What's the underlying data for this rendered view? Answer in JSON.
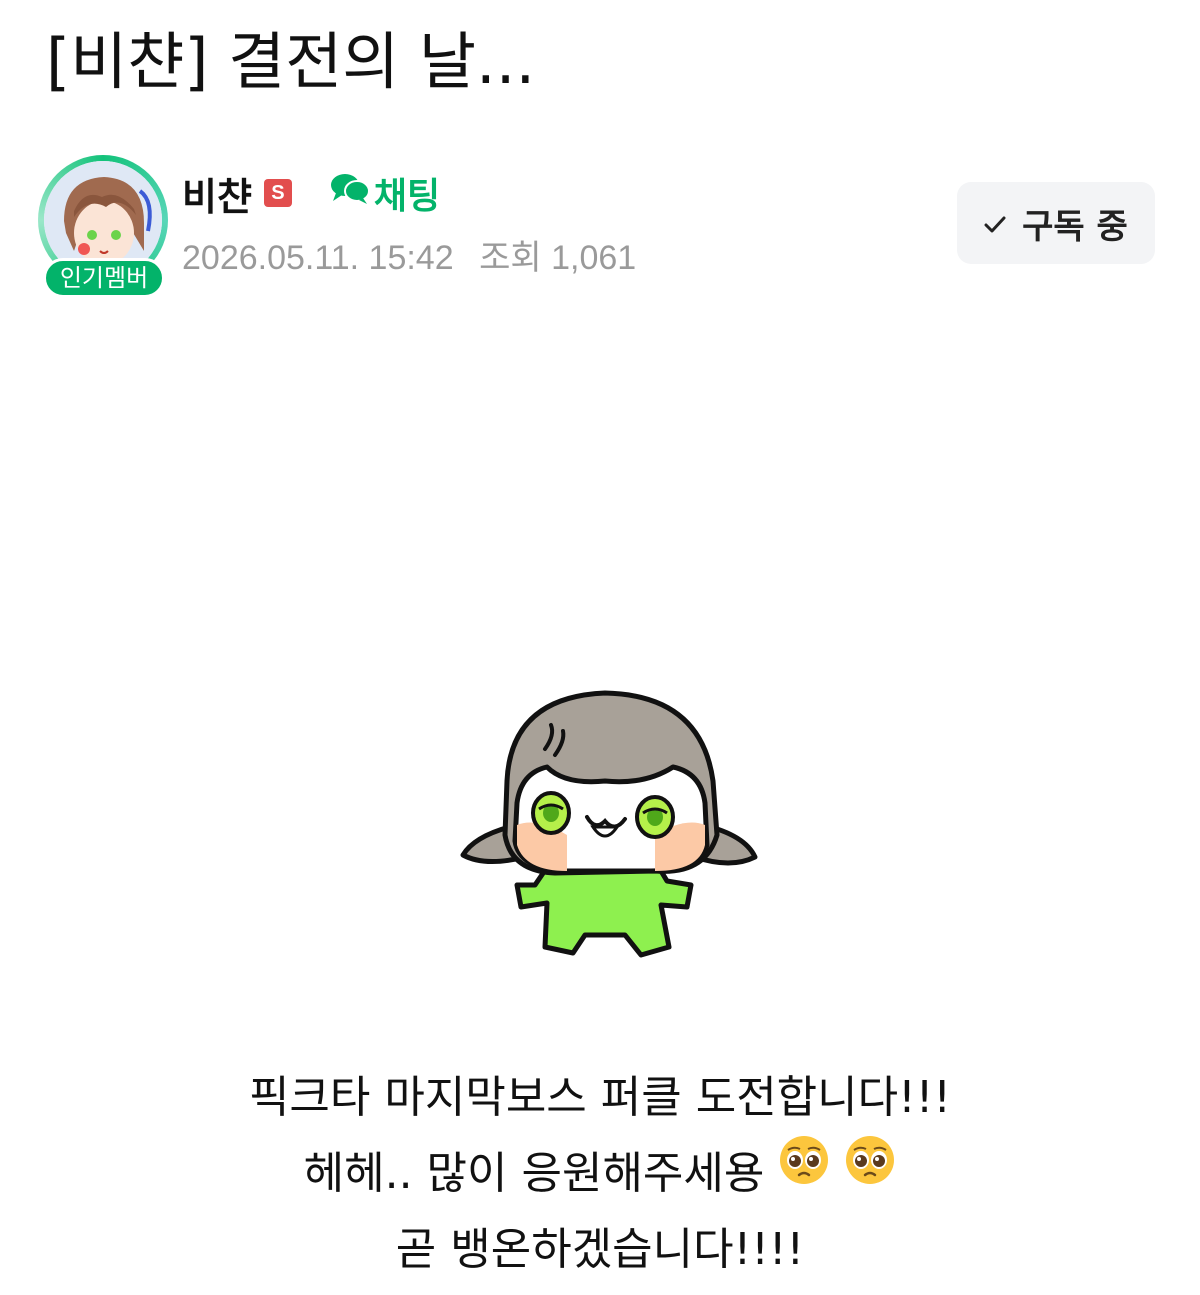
{
  "post": {
    "title": "[비챤] 결전의 날...",
    "body_lines": [
      "픽크타 마지막보스 퍼클 도전합니다!!!",
      "헤헤.. 많이 응원해주세용",
      "곧 뱅온하겠습니다!!!!"
    ]
  },
  "author": {
    "name": "비챤",
    "level_badge": "S",
    "member_badge": "인기멤버",
    "chat_label": "채팅",
    "date": "2026.05.11. 15:42",
    "views_label": "조회 1,061"
  },
  "actions": {
    "subscribe_label": "구독 중"
  },
  "icons": {
    "chat": "chat-bubbles-icon",
    "subscribe_check": "check-icon",
    "emoji": "pleading-face-emoji"
  },
  "colors": {
    "accent_green": "#03b36a",
    "level_badge_red": "#e24e4e",
    "meta_gray": "#9a9a9a",
    "button_bg": "#f3f4f6"
  }
}
